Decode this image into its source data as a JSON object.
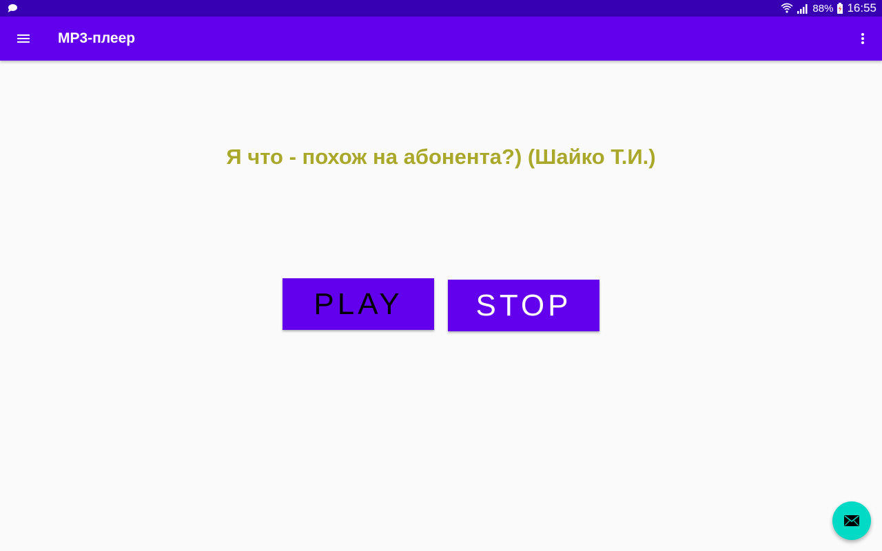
{
  "status_bar": {
    "notification_icon": "chat-bubble-icon",
    "wifi_icon": "wifi-icon",
    "signal_icon": "cell-signal-icon",
    "battery_percent": "88%",
    "battery_icon": "battery-charging-icon",
    "time": "16:55"
  },
  "app_bar": {
    "menu_icon": "hamburger-menu-icon",
    "title": "MP3-плеер",
    "overflow_icon": "more-vert-icon"
  },
  "main": {
    "track_title": "Я что - похож на абонента?) (Шайко Т.И.)",
    "play_label": "PLAY",
    "stop_label": "STOP"
  },
  "fab": {
    "icon": "mail-icon"
  },
  "colors": {
    "status_bar": "#3700b3",
    "primary": "#6200ee",
    "accent": "#03dac5",
    "track_title": "#aaa82a",
    "background": "#fafafa"
  }
}
